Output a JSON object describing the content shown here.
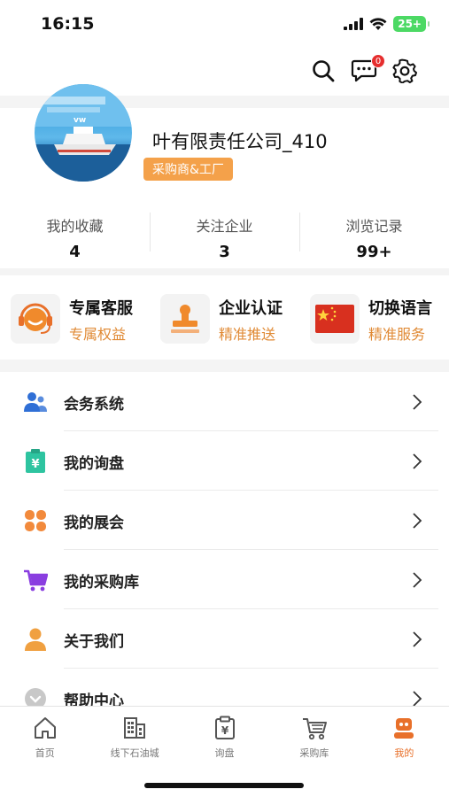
{
  "status": {
    "time": "16:15",
    "battery": "25+"
  },
  "header": {
    "message_badge": "0"
  },
  "profile": {
    "company_name": "叶有限责任公司_410",
    "role": "采购商&工厂",
    "avatar_caption": "vw"
  },
  "stats": [
    {
      "label": "我的收藏",
      "value": "4"
    },
    {
      "label": "关注企业",
      "value": "3"
    },
    {
      "label": "浏览记录",
      "value": "99+"
    }
  ],
  "services": [
    {
      "title": "专属客服",
      "subtitle": "专属权益",
      "icon": "customer-service-icon"
    },
    {
      "title": "企业认证",
      "subtitle": "精准推送",
      "icon": "certification-stamp-icon"
    },
    {
      "title": "切换语言",
      "subtitle": "精准服务",
      "icon": "china-flag-icon"
    }
  ],
  "menu": [
    {
      "label": "会务系统",
      "icon": "meeting-users-icon",
      "color": "#2f6fd6"
    },
    {
      "label": "我的询盘",
      "icon": "inquiry-clipboard-icon",
      "color": "#2ec4a0"
    },
    {
      "label": "我的展会",
      "icon": "exhibition-grid-icon",
      "color": "#f28a3c"
    },
    {
      "label": "我的采购库",
      "icon": "cart-icon",
      "color": "#8a3ee0"
    },
    {
      "label": "关于我们",
      "icon": "person-icon",
      "color": "#f0a040"
    },
    {
      "label": "帮助中心",
      "icon": "help-icon",
      "color": "#c8c8c8"
    }
  ],
  "tabs": [
    {
      "label": "首页",
      "icon": "home-icon"
    },
    {
      "label": "线下石油城",
      "icon": "building-icon"
    },
    {
      "label": "询盘",
      "icon": "inquiry-icon"
    },
    {
      "label": "采购库",
      "icon": "cart-icon"
    },
    {
      "label": "我的",
      "icon": "profile-robot-icon",
      "active": true
    }
  ],
  "colors": {
    "accent": "#e8702a",
    "badge_bg": "#f4a14a",
    "subtitle": "#e08a35"
  }
}
